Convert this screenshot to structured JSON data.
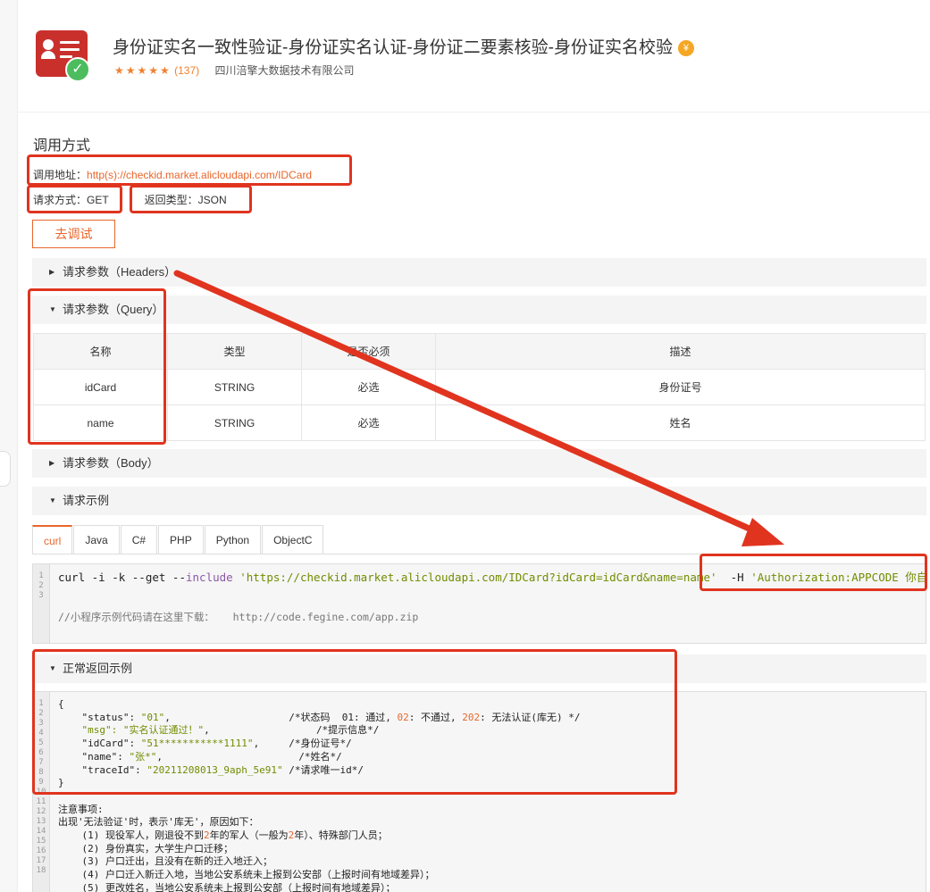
{
  "product": {
    "title": "身份证实名一致性验证-身份证实名认证-身份证二要素核验-身份证实名校验",
    "coin_icon": "¥",
    "stars": "★★★★★",
    "rating_count": "(137)",
    "company": "四川涪擎大数据技术有限公司"
  },
  "call": {
    "section_title": "调用方式",
    "address_label": "调用地址：",
    "address_url": "http(s)://checkid.market.alicloudapi.com/IDCard",
    "method": "请求方式：GET",
    "return_type": "返回类型：JSON",
    "debug_button": "去调试"
  },
  "sections": {
    "headers": "请求参数（Headers）",
    "query": "请求参数（Query）",
    "body": "请求参数（Body）",
    "example": "请求示例",
    "normal_return": "正常返回示例"
  },
  "query_table": {
    "headers": [
      "名称",
      "类型",
      "是否必须",
      "描述"
    ],
    "rows": [
      [
        "idCard",
        "STRING",
        "必选",
        "身份证号"
      ],
      [
        "name",
        "STRING",
        "必选",
        "姓名"
      ]
    ]
  },
  "code_tabs": [
    "curl",
    "Java",
    "C#",
    "PHP",
    "Python",
    "ObjectC"
  ],
  "curl_example": {
    "cmd": "curl -i -k --get --",
    "include": "include",
    "url": "'https://checkid.market.alicloudapi.com/IDCard?idCard=idCard&name=name'",
    "header_flag": "-H",
    "header_value": "'Authorization:APPCODE 你自己的",
    "comment": "//小程序示例代码请在这里下载：   http://code.fegine.com/app.zip"
  },
  "response_example": {
    "l1": "{",
    "status_key": "    \"status\": ",
    "status_val": "\"01\"",
    "status_cm": ",                    /*状态码  01: 通过, ",
    "status_02": "02",
    "status_cm2": ": 不通过, ",
    "status_202": "202",
    "status_cm3": ": 无法认证(库无) */",
    "msg_key": "    \"msg\": ",
    "msg_val": "\"实名认证通过！\"",
    "msg_cm": ",                  /*提示信息*/",
    "idcard_key": "    \"idCard\": ",
    "idcard_val": "\"51***********1111\"",
    "idcard_cm": ",     /*身份证号*/",
    "name_key": "    \"name\": ",
    "name_val": "\"张*\"",
    "name_cm": ",                       /*姓名*/",
    "trace_key": "    \"traceId\": ",
    "trace_val": "\"20211208013_9aph_5e91\"",
    "trace_cm": " /*请求唯一id*/",
    "l_end": "}",
    "notes_title": "注意事项:",
    "notes_intro": "出现'无法验证'时，表示'库无'，原因如下：",
    "n1a": "    (1) 现役军人，刚退役不到",
    "n1b": "2",
    "n1c": "年的军人（一般为",
    "n1d": "2",
    "n1e": "年）、特殊部门人员；",
    "n2": "    (2) 身份真实，大学生户口迁移；",
    "n3": "    (3) 户口迁出，且没有在新的迁入地迁入；",
    "n4": "    (4) 户口迁入新迁入地，当地公安系统未上报到公安部（上报时间有地域差异）；",
    "n5": "    (5) 更改姓名，当地公安系统未上报到公安部（上报时间有地域差异）；"
  },
  "colors": {
    "accent": "#e8662c",
    "highlight": "#e0341f",
    "logo": "#c9302c",
    "check": "#4cbc5e"
  }
}
